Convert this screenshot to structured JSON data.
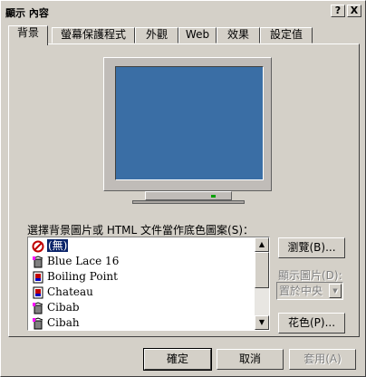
{
  "window": {
    "title": "顯示 內容",
    "help_btn": "?",
    "close_btn": "X"
  },
  "tabs": [
    "背景",
    "螢幕保護程式",
    "外觀",
    "Web",
    "效果",
    "設定值"
  ],
  "background": {
    "list_label": "選擇背景圖片或 HTML 文件當作底色圖案(S)：",
    "items": [
      "(無)",
      "Blue Lace 16",
      "Boiling Point",
      "Chateau",
      "Cibab",
      "Cibah"
    ],
    "selected_index": 0,
    "browse_btn": "瀏覽(B)...",
    "display_label": "顯示圖片(D):",
    "display_value": "置於中央",
    "pattern_btn": "花色(P)..."
  },
  "footer": {
    "ok": "確定",
    "cancel": "取消",
    "apply": "套用(A)"
  },
  "colors": {
    "desktop": "#3a6ea5",
    "selection": "#0a246a"
  }
}
